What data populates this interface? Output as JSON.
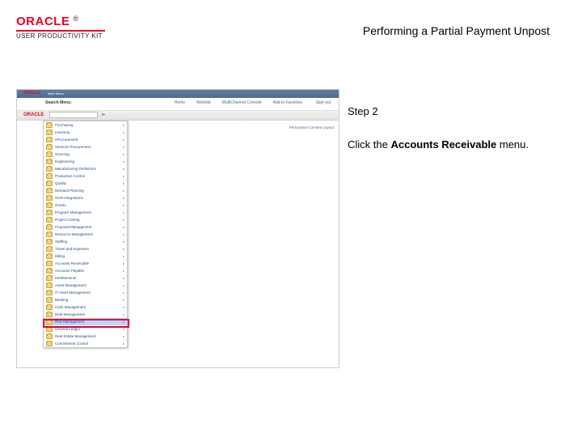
{
  "header": {
    "brand": "ORACLE",
    "trademarks": "®",
    "product_line": "USER PRODUCTIVITY KIT"
  },
  "title": "Performing a Partial Payment Unpost",
  "step": {
    "label": "Step 2",
    "before": "Click the ",
    "bold": "Accounts Receivable",
    "after": " menu."
  },
  "screenshot": {
    "brand": "ORACLE",
    "main_menu": "Main Menu",
    "search_label": "Search Menu:",
    "search_placeholder": "",
    "nav_links": [
      "Home",
      "Worklist",
      "MultiChannel Console",
      "Add to Favorites"
    ],
    "nav_last": "Sign out",
    "personalize": "Personalize Content  Layout",
    "menu_items": [
      "Purchasing",
      "Inventory",
      "eProcurement",
      "Services Procurement",
      "Sourcing",
      "Engineering",
      "Manufacturing Definitions",
      "Production Control",
      "Quality",
      "Demand Planning",
      "SCM Integrations",
      "Grants",
      "Program Management",
      "Project Costing",
      "Proposal Management",
      "Resource Management",
      "Staffing",
      "Travel and Expenses",
      "Billing",
      "Accounts Receivable",
      "Accounts Payable",
      "eSettlements",
      "Asset Management",
      "IT Asset Management",
      "Banking",
      "Cash Management",
      "Deal Management",
      "Risk Management",
      "General Ledger",
      "Real Estate Management",
      "Commitment Control"
    ],
    "highlight_index": 27
  }
}
